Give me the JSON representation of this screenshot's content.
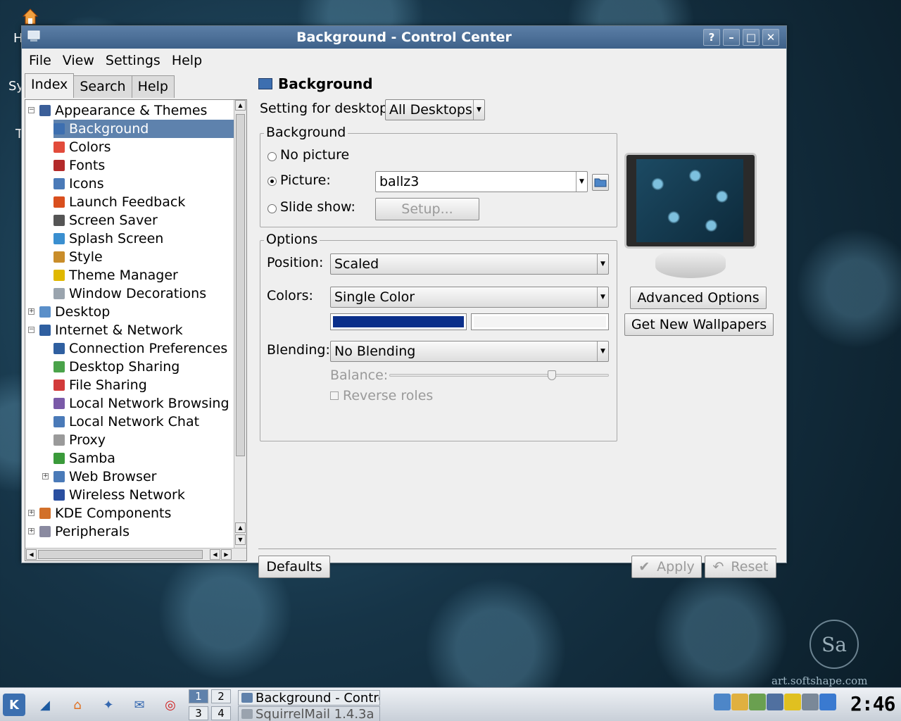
{
  "desktop": {
    "side_letters": [
      "H",
      "Sy",
      "T"
    ],
    "watermark": "art.softshape.com",
    "seal": "Sa"
  },
  "window": {
    "title": "Background - Control Center",
    "buttons": {
      "help": "?",
      "minimize": "–",
      "maximize": "□",
      "close": "✕"
    }
  },
  "menu": {
    "items": [
      "File",
      "View",
      "Settings",
      "Help"
    ]
  },
  "tabs": [
    {
      "label": "Index",
      "active": true
    },
    {
      "label": "Search",
      "active": false
    },
    {
      "label": "Help",
      "active": false
    }
  ],
  "tree": {
    "items": [
      {
        "label": "Appearance & Themes",
        "level": 0,
        "expander": "−",
        "icon_color": "#3b5f99",
        "icon": "appearance-icon"
      },
      {
        "label": "Background",
        "level": 1,
        "selected": true,
        "icon_color": "#3d6fb0",
        "icon": "background-icon"
      },
      {
        "label": "Colors",
        "level": 1,
        "icon_color": "#e24b3b",
        "icon": "colors-icon"
      },
      {
        "label": "Fonts",
        "level": 1,
        "icon_color": "#b32a2a",
        "icon": "fonts-icon"
      },
      {
        "label": "Icons",
        "level": 1,
        "icon_color": "#4a7ab8",
        "icon": "icons-icon"
      },
      {
        "label": "Launch Feedback",
        "level": 1,
        "icon_color": "#d94f1e",
        "icon": "launch-feedback-icon"
      },
      {
        "label": "Screen Saver",
        "level": 1,
        "icon_color": "#555555",
        "icon": "screen-saver-icon"
      },
      {
        "label": "Splash Screen",
        "level": 1,
        "icon_color": "#3a8fd0",
        "icon": "splash-screen-icon"
      },
      {
        "label": "Style",
        "level": 1,
        "icon_color": "#c98d2a",
        "icon": "style-icon"
      },
      {
        "label": "Theme Manager",
        "level": 1,
        "icon_color": "#e0b800",
        "icon": "theme-manager-icon"
      },
      {
        "label": "Window Decorations",
        "level": 1,
        "icon_color": "#9aa4ae",
        "icon": "window-decorations-icon"
      },
      {
        "label": "Desktop",
        "level": 0,
        "expander": "+",
        "icon_color": "#5a8fc9",
        "icon": "desktop-icon"
      },
      {
        "label": "Internet & Network",
        "level": 0,
        "expander": "−",
        "icon_color": "#2f5fa0",
        "icon": "internet-icon"
      },
      {
        "label": "Connection Preferences",
        "level": 1,
        "icon_color": "#2f5fa0",
        "icon": "connection-preferences-icon"
      },
      {
        "label": "Desktop Sharing",
        "level": 1,
        "icon_color": "#4aa34a",
        "icon": "desktop-sharing-icon"
      },
      {
        "label": "File Sharing",
        "level": 1,
        "icon_color": "#d23a3a",
        "icon": "file-sharing-icon"
      },
      {
        "label": "Local Network Browsing",
        "level": 1,
        "icon_color": "#7a5aa8",
        "icon": "local-network-browsing-icon"
      },
      {
        "label": "Local Network Chat",
        "level": 1,
        "icon_color": "#4a7ab8",
        "icon": "local-network-chat-icon"
      },
      {
        "label": "Proxy",
        "level": 1,
        "icon_color": "#9a9a9a",
        "icon": "proxy-icon"
      },
      {
        "label": "Samba",
        "level": 1,
        "icon_color": "#3a9a3a",
        "icon": "samba-icon"
      },
      {
        "label": "Web Browser",
        "level": 1,
        "expander": "+",
        "icon_color": "#4a7ab8",
        "icon": "web-browser-icon"
      },
      {
        "label": "Wireless Network",
        "level": 1,
        "icon_color": "#2a4fa0",
        "icon": "wireless-network-icon"
      },
      {
        "label": "KDE Components",
        "level": 0,
        "expander": "+",
        "icon_color": "#d2702a",
        "icon": "kde-components-icon"
      },
      {
        "label": "Peripherals",
        "level": 0,
        "expander": "+",
        "icon_color": "#8a8aa0",
        "icon": "peripherals-icon"
      }
    ]
  },
  "module": {
    "header": "Background",
    "desktop_label": "Setting for desktop:",
    "desktop_value": "All Desktops",
    "background_group": "Background",
    "no_picture": "No picture",
    "picture": "Picture:",
    "picture_value": "ballz3",
    "slide_show": "Slide show:",
    "setup": "Setup...",
    "selected_mode": "picture",
    "options_group": "Options",
    "position_label": "Position:",
    "position_value": "Scaled",
    "colors_label": "Colors:",
    "colors_value": "Single Color",
    "color_primary": "#0b2f8a",
    "color_secondary": "#f4f4f4",
    "blending_label": "Blending:",
    "blending_value": "No Blending",
    "balance_label": "Balance:",
    "balance_value": 0.74,
    "reverse_roles": "Reverse roles",
    "advanced_options": "Advanced Options",
    "get_new_wallpapers": "Get New Wallpapers",
    "defaults": "Defaults",
    "apply": "Apply",
    "reset": "Reset"
  },
  "taskbar": {
    "pager": [
      "1",
      "2",
      "3",
      "4"
    ],
    "current_desktop": "1",
    "tasks": [
      {
        "label": "Background - Control Center",
        "active": true
      },
      {
        "label": "SquirrelMail 1.4.3a",
        "active": false
      }
    ],
    "clock": "2:46"
  }
}
